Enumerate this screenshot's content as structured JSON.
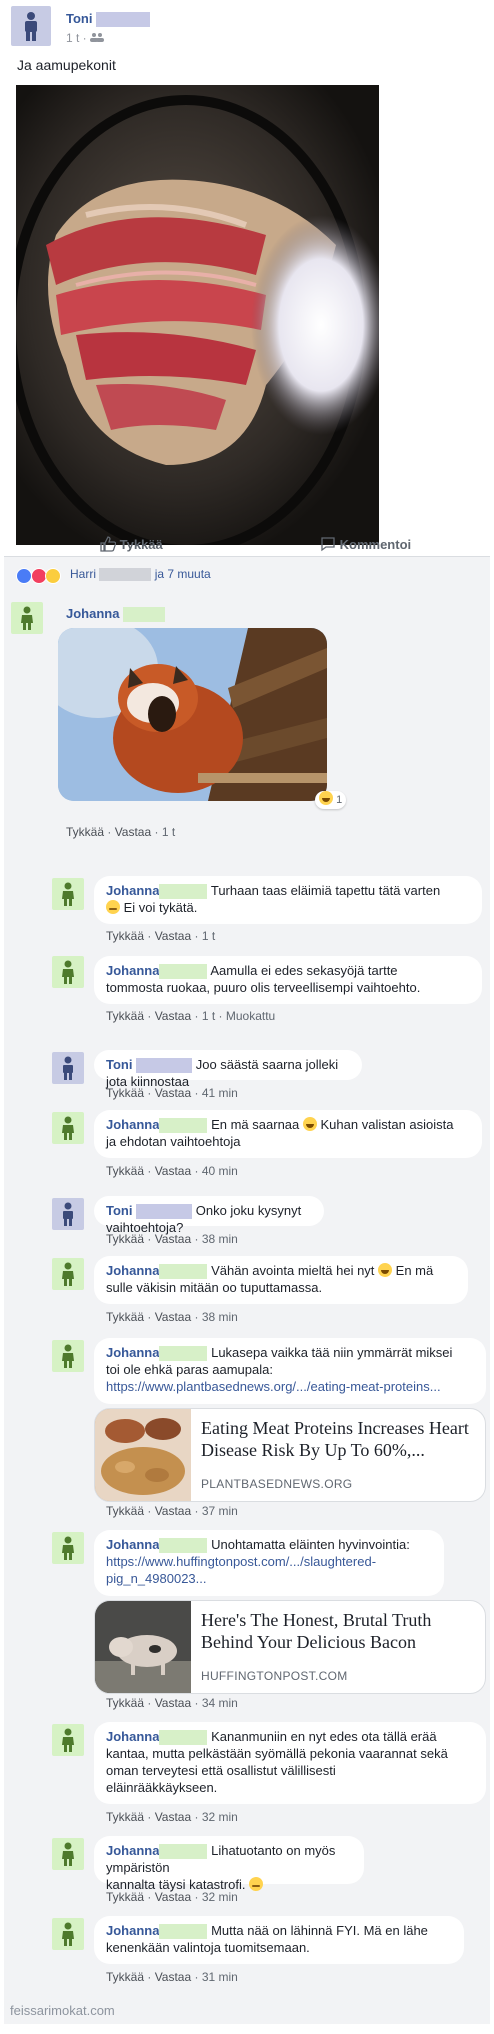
{
  "post": {
    "author": "Toni",
    "meta": "1 t ·",
    "text": "Ja aamupekonit",
    "like_label": "Tykkää",
    "comment_label": "Kommentoi"
  },
  "reactions": {
    "names_prefix": "Harri",
    "names_suffix": "ja 7 muuta"
  },
  "comments": [
    {
      "author": "Johanna",
      "text": "",
      "like": "Tykkää",
      "reply": "Vastaa",
      "time": "1 t",
      "reaction_count": "1"
    },
    {
      "author": "Johanna",
      "text_a": "Turhaan taas eläimiä tapettu tätä varten",
      "text_b": "Ei voi tykätä.",
      "like": "Tykkää",
      "reply": "Vastaa",
      "time": "1 t"
    },
    {
      "author": "Johanna",
      "text_a": "Aamulla ei edes sekasyöjä tartte",
      "text_b": "tommosta ruokaa, puuro olis terveellisempi vaihtoehto.",
      "like": "Tykkää",
      "reply": "Vastaa",
      "time": "1 t",
      "edited": "Muokattu"
    },
    {
      "author": "Toni",
      "text": "Joo säästä saarna jolleki jota kiinnostaa",
      "like": "Tykkää",
      "reply": "Vastaa",
      "time": "41 min"
    },
    {
      "author": "Johanna",
      "text_a": "En mä saarnaa",
      "text_a2": "Kuhan valistan asioista",
      "text_b": "ja ehdotan vaihtoehtoja",
      "like": "Tykkää",
      "reply": "Vastaa",
      "time": "40 min"
    },
    {
      "author": "Toni",
      "text": "Onko joku kysynyt vaihtoehtoja?",
      "like": "Tykkää",
      "reply": "Vastaa",
      "time": "38 min"
    },
    {
      "author": "Johanna",
      "text_a": "Vähän avointa mieltä hei nyt",
      "text_a2": "En mä",
      "text_b": "sulle väkisin mitään oo tuputtamassa.",
      "like": "Tykkää",
      "reply": "Vastaa",
      "time": "38 min"
    },
    {
      "author": "Johanna",
      "text_a": "Lukasepa vaikka tää niin ymmärrät miksei",
      "text_b": "toi ole ehkä paras aamupala:",
      "link": "https://www.plantbasednews.org/.../eating-meat-proteins...",
      "preview_title": "Eating Meat Proteins Increases Heart Disease Risk By Up To 60%,...",
      "preview_domain": "PLANTBASEDNEWS.ORG",
      "like": "Tykkää",
      "reply": "Vastaa",
      "time": "37 min"
    },
    {
      "author": "Johanna",
      "text_a": "Unohtamatta eläinten hyvinvointia:",
      "link_a": "https://www.huffingtonpost.com/.../slaughtered-",
      "link_b": "pig_n_4980023...",
      "preview_title": "Here's The Honest, Brutal Truth Behind Your Delicious Bacon",
      "preview_domain": "HUFFINGTONPOST.COM",
      "like": "Tykkää",
      "reply": "Vastaa",
      "time": "34 min"
    },
    {
      "author": "Johanna",
      "text_a": "Kananmuniin en nyt edes ota tällä erää",
      "text_b": "kantaa, mutta pelkästään syömällä pekonia vaarannat sekä",
      "text_c": "oman terveytesi että osallistut välillisesti",
      "text_d": "eläinrääkkäykseen.",
      "like": "Tykkää",
      "reply": "Vastaa",
      "time": "32 min"
    },
    {
      "author": "Johanna",
      "text_a": "Lihatuotanto on myös ympäristön",
      "text_b": "kannalta täysi katastrofi.",
      "like": "Tykkää",
      "reply": "Vastaa",
      "time": "32 min"
    },
    {
      "author": "Johanna",
      "text_a": "Mutta nää on lähinnä FYI. Mä en lähe",
      "text_b": "kenenkään valintoja tuomitsemaan.",
      "like": "Tykkää",
      "reply": "Vastaa",
      "time": "31 min"
    }
  ],
  "watermark": "feissarimokat.com",
  "colors": {
    "link": "#365899",
    "background": "#f2f3f5",
    "avatar_blue": "#c7cbe4",
    "avatar_green": "#d6f2c4"
  }
}
